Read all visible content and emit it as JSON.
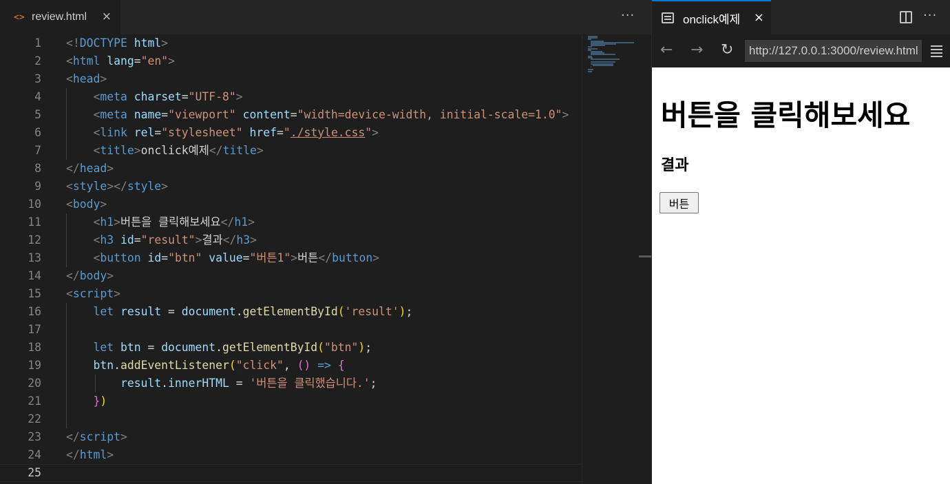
{
  "editor": {
    "tab": {
      "icon": "code-file-icon",
      "icon_glyph": "<>",
      "label": "review.html",
      "close": "×"
    },
    "more": "···",
    "active_line": 25,
    "lines": [
      [
        [
          "br",
          "<!"
        ],
        [
          "tag",
          "DOCTYPE"
        ],
        [
          "txt",
          " "
        ],
        [
          "att",
          "html"
        ],
        [
          "br",
          ">"
        ]
      ],
      [
        [
          "br",
          "<"
        ],
        [
          "tag",
          "html"
        ],
        [
          "txt",
          " "
        ],
        [
          "att",
          "lang"
        ],
        [
          "txt",
          "="
        ],
        [
          "str",
          "\"en\""
        ],
        [
          "br",
          ">"
        ]
      ],
      [
        [
          "br",
          "<"
        ],
        [
          "tag",
          "head"
        ],
        [
          "br",
          ">"
        ]
      ],
      [
        [
          "txt",
          "    "
        ],
        [
          "br",
          "<"
        ],
        [
          "tag",
          "meta"
        ],
        [
          "txt",
          " "
        ],
        [
          "att",
          "charset"
        ],
        [
          "txt",
          "="
        ],
        [
          "str",
          "\"UTF-8\""
        ],
        [
          "br",
          ">"
        ]
      ],
      [
        [
          "txt",
          "    "
        ],
        [
          "br",
          "<"
        ],
        [
          "tag",
          "meta"
        ],
        [
          "txt",
          " "
        ],
        [
          "att",
          "name"
        ],
        [
          "txt",
          "="
        ],
        [
          "str",
          "\"viewport\""
        ],
        [
          "txt",
          " "
        ],
        [
          "att",
          "content"
        ],
        [
          "txt",
          "="
        ],
        [
          "str",
          "\"width=device-width, initial-scale=1.0\""
        ],
        [
          "br",
          ">"
        ]
      ],
      [
        [
          "txt",
          "    "
        ],
        [
          "br",
          "<"
        ],
        [
          "tag",
          "link"
        ],
        [
          "txt",
          " "
        ],
        [
          "att",
          "rel"
        ],
        [
          "txt",
          "="
        ],
        [
          "str",
          "\"stylesheet\""
        ],
        [
          "txt",
          " "
        ],
        [
          "att",
          "href"
        ],
        [
          "txt",
          "="
        ],
        [
          "str",
          "\""
        ],
        [
          "link",
          "./style.css"
        ],
        [
          "str",
          "\""
        ],
        [
          "br",
          ">"
        ]
      ],
      [
        [
          "txt",
          "    "
        ],
        [
          "br",
          "<"
        ],
        [
          "tag",
          "title"
        ],
        [
          "br",
          ">"
        ],
        [
          "txt",
          "onclick예제"
        ],
        [
          "br",
          "</"
        ],
        [
          "tag",
          "title"
        ],
        [
          "br",
          ">"
        ]
      ],
      [
        [
          "br",
          "</"
        ],
        [
          "tag",
          "head"
        ],
        [
          "br",
          ">"
        ]
      ],
      [
        [
          "br",
          "<"
        ],
        [
          "tag",
          "style"
        ],
        [
          "br",
          "></"
        ],
        [
          "tag",
          "style"
        ],
        [
          "br",
          ">"
        ]
      ],
      [
        [
          "br",
          "<"
        ],
        [
          "tag",
          "body"
        ],
        [
          "br",
          ">"
        ]
      ],
      [
        [
          "txt",
          "    "
        ],
        [
          "br",
          "<"
        ],
        [
          "tag",
          "h1"
        ],
        [
          "br",
          ">"
        ],
        [
          "txt",
          "버튼을 클릭해보세요"
        ],
        [
          "br",
          "</"
        ],
        [
          "tag",
          "h1"
        ],
        [
          "br",
          ">"
        ]
      ],
      [
        [
          "txt",
          "    "
        ],
        [
          "br",
          "<"
        ],
        [
          "tag",
          "h3"
        ],
        [
          "txt",
          " "
        ],
        [
          "att",
          "id"
        ],
        [
          "txt",
          "="
        ],
        [
          "str",
          "\"result\""
        ],
        [
          "br",
          ">"
        ],
        [
          "txt",
          "결과"
        ],
        [
          "br",
          "</"
        ],
        [
          "tag",
          "h3"
        ],
        [
          "br",
          ">"
        ]
      ],
      [
        [
          "txt",
          "    "
        ],
        [
          "br",
          "<"
        ],
        [
          "tag",
          "button"
        ],
        [
          "txt",
          " "
        ],
        [
          "att",
          "id"
        ],
        [
          "txt",
          "="
        ],
        [
          "str",
          "\"btn\""
        ],
        [
          "txt",
          " "
        ],
        [
          "att",
          "value"
        ],
        [
          "txt",
          "="
        ],
        [
          "str",
          "\"버튼1\""
        ],
        [
          "br",
          ">"
        ],
        [
          "txt",
          "버튼"
        ],
        [
          "br",
          "</"
        ],
        [
          "tag",
          "button"
        ],
        [
          "br",
          ">"
        ]
      ],
      [
        [
          "br",
          "</"
        ],
        [
          "tag",
          "body"
        ],
        [
          "br",
          ">"
        ]
      ],
      [
        [
          "br",
          "<"
        ],
        [
          "tag",
          "script"
        ],
        [
          "br",
          ">"
        ]
      ],
      [
        [
          "txt",
          "    "
        ],
        [
          "kw",
          "let"
        ],
        [
          "txt",
          " "
        ],
        [
          "var",
          "result"
        ],
        [
          "txt",
          " = "
        ],
        [
          "var",
          "document"
        ],
        [
          "txt",
          "."
        ],
        [
          "fn",
          "getElementById"
        ],
        [
          "p1",
          "("
        ],
        [
          "str",
          "'result'"
        ],
        [
          "p1",
          ")"
        ],
        [
          "txt",
          ";"
        ]
      ],
      [],
      [
        [
          "txt",
          "    "
        ],
        [
          "kw",
          "let"
        ],
        [
          "txt",
          " "
        ],
        [
          "var",
          "btn"
        ],
        [
          "txt",
          " = "
        ],
        [
          "var",
          "document"
        ],
        [
          "txt",
          "."
        ],
        [
          "fn",
          "getElementById"
        ],
        [
          "p1",
          "("
        ],
        [
          "str",
          "\"btn\""
        ],
        [
          "p1",
          ")"
        ],
        [
          "txt",
          ";"
        ]
      ],
      [
        [
          "txt",
          "    "
        ],
        [
          "var",
          "btn"
        ],
        [
          "txt",
          "."
        ],
        [
          "fn",
          "addEventListener"
        ],
        [
          "p1",
          "("
        ],
        [
          "str",
          "\"click\""
        ],
        [
          "txt",
          ", "
        ],
        [
          "p2",
          "()"
        ],
        [
          "txt",
          " "
        ],
        [
          "kw",
          "=>"
        ],
        [
          "txt",
          " "
        ],
        [
          "p2",
          "{"
        ]
      ],
      [
        [
          "txt",
          "        "
        ],
        [
          "var",
          "result"
        ],
        [
          "txt",
          "."
        ],
        [
          "var",
          "innerHTML"
        ],
        [
          "txt",
          " = "
        ],
        [
          "str",
          "'버튼을 클릭했습니다.'"
        ],
        [
          "txt",
          ";"
        ]
      ],
      [
        [
          "txt",
          "    "
        ],
        [
          "p2",
          "}"
        ],
        [
          "p1",
          ")"
        ]
      ],
      [],
      [
        [
          "br",
          "</"
        ],
        [
          "tag",
          "script"
        ],
        [
          "br",
          ">"
        ]
      ],
      [
        [
          "br",
          "</"
        ],
        [
          "tag",
          "html"
        ],
        [
          "br",
          ">"
        ]
      ],
      []
    ]
  },
  "preview": {
    "tab": {
      "icon": "preview-icon",
      "label": "onclick예제",
      "close": "×"
    },
    "split_icon": "split-editor-icon",
    "more": "···",
    "nav": {
      "back": "←",
      "forward": "→",
      "reload": "↻",
      "url": "http://127.0.0.1:3000/review.html",
      "menu_icon": "menu-icon"
    },
    "page": {
      "h1": "버튼을 클릭해보세요",
      "h3": "결과",
      "button": "버튼"
    }
  },
  "colors": {
    "background": "#1e1e1e",
    "tag": "#569cd6",
    "attribute": "#9cdcfe",
    "string": "#ce9178",
    "function": "#dcdcaa",
    "accent": "#0078d4"
  }
}
